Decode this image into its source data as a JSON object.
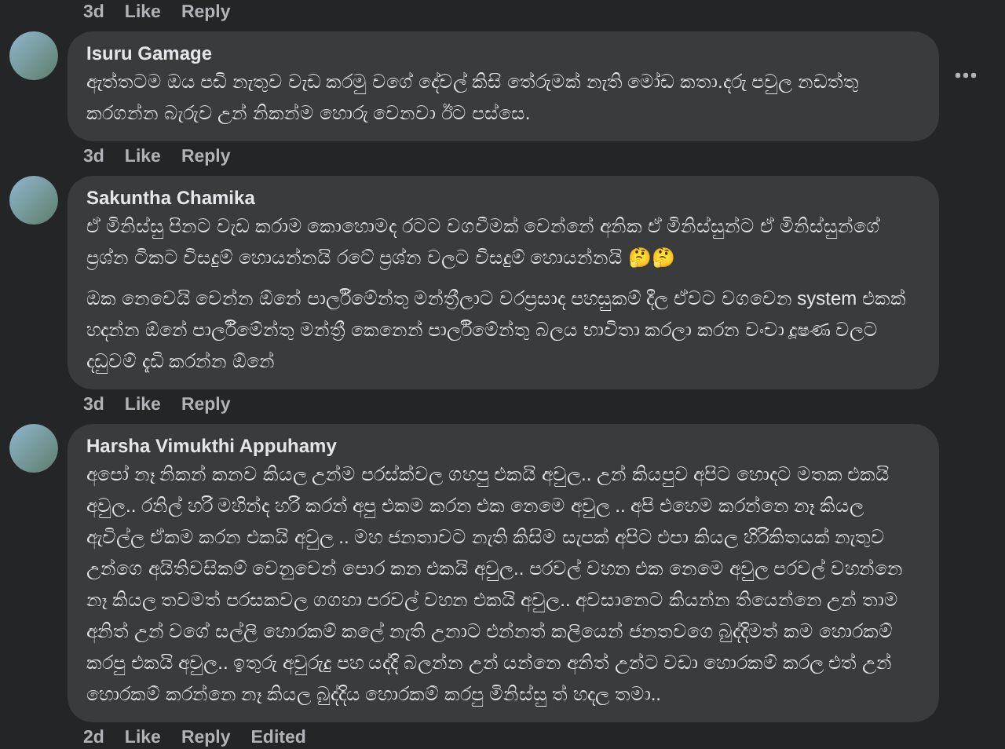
{
  "top_actions": {
    "time": "3d",
    "actions": [
      "Like",
      "Reply"
    ]
  },
  "comments": [
    {
      "author": "Isuru Gamage",
      "more_menu": true,
      "paragraphs": [
        "ඇත්තටම ඔය පඩි නැතුව වැඩ කරමු වගේ දේවල් කිසි තේරුමක් නැති මෝඩ කතා.දරු පවුල නඩත්තු කරගන්න බැරුව උන් නිකන්ම හොරු වෙනවා ඊට පස්සෙ."
      ],
      "time": "3d",
      "actions": [
        "Like",
        "Reply"
      ]
    },
    {
      "author": "Sakuntha Chamika",
      "more_menu": false,
      "paragraphs": [
        "ඒ මිනිස්සු පිනට වැඩ කරාම කොහොමද රටට වගවීමක් වෙන්නේ අනික ඒ මිනිස්සුන්ට ඒ මිනිස්සුන්ගේ ප්‍රශ්න ටිකට විසදුම් හොයන්නයි රටේ ප්‍රශ්න වලට විසදුම් හොයන්නයි 🤔🤔",
        "ඔක නෙවෙයි වෙන්න ඕනේ පාර්ලිමේන්තු මන්ත්‍රීලාට වරප්‍රසාද පහසුකම් දීල ඒවට වගවෙන system එකක් හදන්න ඕනේ පාර්ලිමේන්තු මන්ත්‍රී කෙනෙන් පාර්ලිමේන්තු බලය භාවිතා කරලා කරන වංචා දූෂණ වලට දඩුවම් දැඩි කරන්න ඕනේ"
      ],
      "time": "3d",
      "actions": [
        "Like",
        "Reply"
      ]
    },
    {
      "author": "Harsha Vimukthi Appuhamy",
      "more_menu": false,
      "paragraphs": [
        "අපෝ නෑ නිකන් කනව කියල උන්ම පරස්ක්වල ගහපු එකයි අවුල.. උන් කියපුව අපිට හොදට මතක එකයි අවුල.. රනිල් හරි මහින්ද හරි කරන් අපු එකම කරන එක නෙමෙ අවුල .. අපි එහෙම කරන්නෙ නෑ කියල ඇවිල්ල ඒකම කරන එකයි අවුල .. මහ ජනතාවට නැති කිසිම සැපක් අපිට එපා කියල හිරිකිතයක් නැතුව උන්ගෙ අයිතිවසිකම් වෙනුවෙන් පොර කන එකයි අවුල.. පරවල් වහන එක නෙමෙ අවුල පරවල් වහන්නෙ නෑ කියල තවමත් පරසකවල ගගහා පරවල් වහන එකයි අවුල.. අවසානෙට කියන්න තියෙන්නෙ උන් තාම අනිත් උන් වගේ සල්ලි හොරකම් කලේ නැති උනාට එන්නත් කලියෙන් ජනතවගෙ බුද්දිමත් කම හොරකම් කරපු එකයි අවුල.. ඉතුරු අවුරුදු පහ යද්දි බලන්න උන් යන්නෙ අනිත් උන්ට වඩා හොරකම් කරල එත් උන් හොරකම් කරන්නෙ නෑ කියල බුද්දිය හොරකම් කරපු මිනිස්සු ත් හදල තමා.."
      ],
      "time": "2d",
      "actions": [
        "Like",
        "Reply"
      ],
      "edited": "Edited"
    }
  ]
}
